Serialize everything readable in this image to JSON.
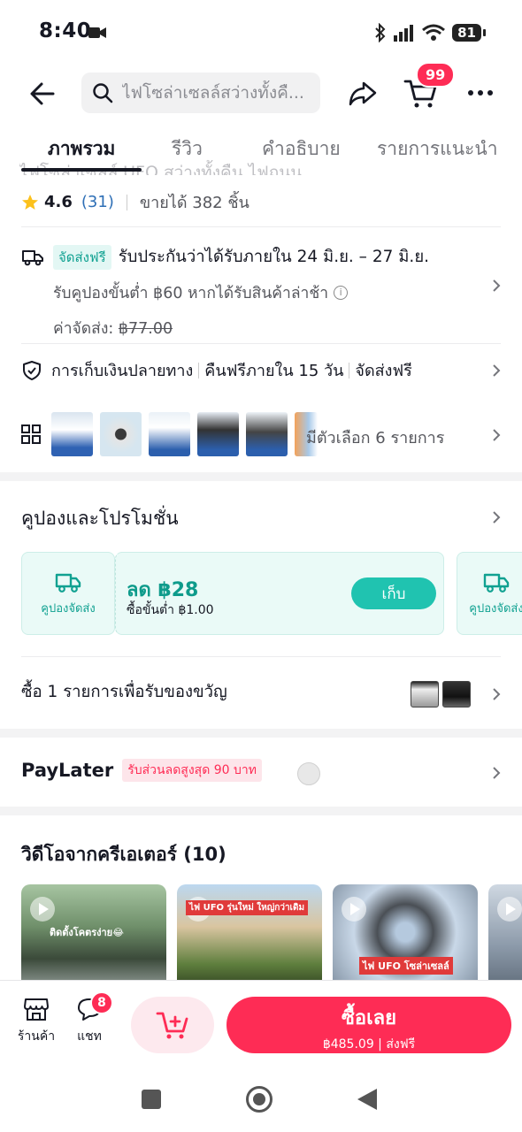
{
  "status_bar": {
    "time": "8:40",
    "battery": "81"
  },
  "header": {
    "search_placeholder": "ไฟโซล่าเซลล์สว่างทั้งคื...",
    "cart_count": "99"
  },
  "tabs": [
    {
      "label": "ภาพรวม",
      "active": true
    },
    {
      "label": "รีวิว",
      "active": false
    },
    {
      "label": "คำอธิบาย",
      "active": false
    },
    {
      "label": "รายการแนะนำ",
      "active": false
    }
  ],
  "product": {
    "title_cut": "ไฟโซล่าเซลล์ UFO สว่างทั้งคืน ไฟถนน ...",
    "rating": "4.6",
    "review_count": "(31)",
    "sold": "ขายได้ 382 ชิ้น"
  },
  "shipping": {
    "free_tag": "จัดส่งฟรี",
    "guarantee": "รับประกันว่าได้รับภายใน 24 มิ.ย. – 27 มิ.ย.",
    "late_coupon": "รับคูปองขั้นต่ำ ฿60 หากได้รับสินค้าล่าช้า",
    "fee_label": "ค่าจัดส่ง:",
    "fee_original": "฿77.00"
  },
  "services": {
    "cod": "การเก็บเงินปลายทาง",
    "free_return": "คืนฟรีภายใน 15 วัน",
    "free_ship": "จัดส่งฟรี"
  },
  "variants": {
    "label": "มีตัวเลือก 6 รายการ"
  },
  "coupons": {
    "section_title": "คูปองและโปรโมชั่น",
    "ship_coupon_label": "คูปองจัดส่ง",
    "amount": "ลด ฿28",
    "min_spend": "ซื้อขั้นต่ำ ฿1.00",
    "collect": "เก็บ",
    "next_label": "คูปองจัดส่ง"
  },
  "gift": {
    "label": "ซื้อ 1 รายการเพื่อรับของขวัญ"
  },
  "paylater": {
    "label": "PayLater",
    "tag": "รับส่วนลดสูงสุด 90 บาท"
  },
  "videos": {
    "section_title": "วิดีโอจากครีเอเตอร์ (10)",
    "captions": [
      "ติดตั้งโคตรง่าย😂",
      "ไฟ UFO รุ่นใหม่ ใหญ่กว่าเดิม",
      "ไฟ UFO โซล่าเซลล์"
    ]
  },
  "bottom_bar": {
    "shop": "ร้านค้า",
    "chat": "แชท",
    "chat_count": "8",
    "buy_now": "ซื้อเลย",
    "price": "฿485.09",
    "free_ship": "ส่งฟรี"
  },
  "colors": {
    "accent": "#fe2c55",
    "teal": "#10a191"
  }
}
